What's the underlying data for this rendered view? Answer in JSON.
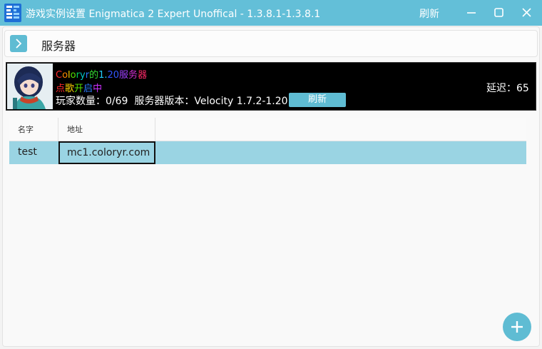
{
  "window": {
    "title": "游戏实例设置 Enigmatica 2 Expert Unoffical - 1.3.8.1-1.3.8.1",
    "refresh_label": "刷新"
  },
  "nav": {
    "title": "服务器"
  },
  "server": {
    "motd_line1": [
      {
        "text": "C",
        "color": "#ff2a2a"
      },
      {
        "text": "o",
        "color": "#ff8a00"
      },
      {
        "text": "l",
        "color": "#ffd400"
      },
      {
        "text": "o",
        "color": "#55e000"
      },
      {
        "text": "r",
        "color": "#00d060"
      },
      {
        "text": "y",
        "color": "#00c8c8"
      },
      {
        "text": "r",
        "color": "#2a7bff"
      },
      {
        "text": "的",
        "color": "#33dd33"
      },
      {
        "text": "1.",
        "color": "#22ccff"
      },
      {
        "text": "20",
        "color": "#3355ff"
      },
      {
        "text": "服",
        "color": "#a040ff"
      },
      {
        "text": "务",
        "color": "#d030d0"
      },
      {
        "text": "器",
        "color": "#ff2a6a"
      }
    ],
    "motd_line2": [
      {
        "text": "点",
        "color": "#ff2a2a"
      },
      {
        "text": "歌",
        "color": "#ffd400"
      },
      {
        "text": "开",
        "color": "#55e000"
      },
      {
        "text": "启",
        "color": "#2a7bff"
      },
      {
        "text": "中",
        "color": "#cc30ff"
      }
    ],
    "players_label": "玩家数量：",
    "players_value": "0/69",
    "version_label": "服务器版本：",
    "version_value": "Velocity 1.7.2-1.20.4",
    "refresh_label": "刷新",
    "latency_label": "延迟：",
    "latency_value": "65"
  },
  "table": {
    "headers": [
      "名字",
      "地址"
    ],
    "rows": [
      {
        "name": "test",
        "address": "mc1.coloryr.com"
      }
    ]
  },
  "icons": {
    "app": "app-logo-icon",
    "minimize": "minimize-icon",
    "maximize": "maximize-icon",
    "close": "close-icon",
    "nav": "chevron-right-icon",
    "add": "plus-icon"
  },
  "colors": {
    "accent": "#5fbcd3",
    "titlebar": "#63bfd8",
    "selected_row": "#9ad4e3",
    "card_bg": "#000000"
  }
}
